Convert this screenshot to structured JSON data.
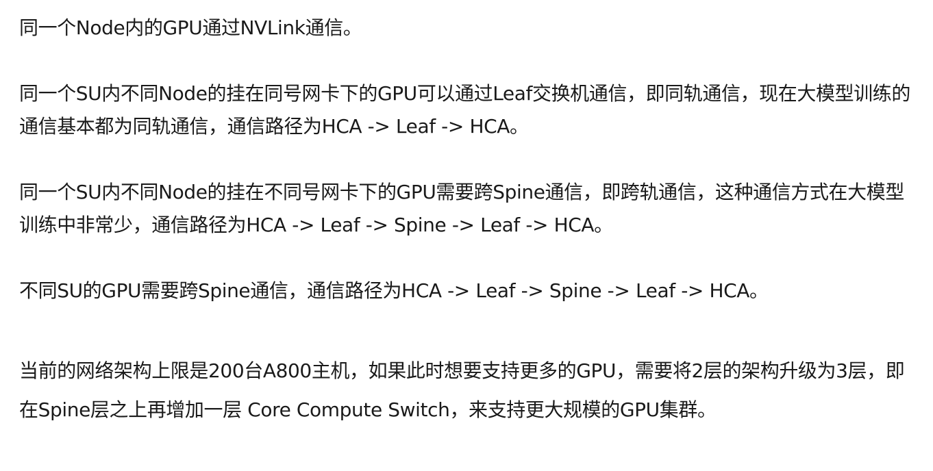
{
  "paragraphs": [
    "同一个Node内的GPU通过NVLink通信。",
    "同一个SU内不同Node的挂在同号网卡下的GPU可以通过Leaf交换机通信，即同轨通信，现在大模型训练的通信基本都为同轨通信，通信路径为HCA -> Leaf -> HCA。",
    "同一个SU内不同Node的挂在不同号网卡下的GPU需要跨Spine通信，即跨轨通信，这种通信方式在大模型训练中非常少，通信路径为HCA -> Leaf -> Spine -> Leaf -> HCA。",
    "不同SU的GPU需要跨Spine通信，通信路径为HCA -> Leaf -> Spine -> Leaf -> HCA。",
    "当前的网络架构上限是200台A800主机，如果此时想要支持更多的GPU，需要将2层的架构升级为3层，即在Spine层之上再增加一层 Core Compute Switch，来支持更大规模的GPU集群。"
  ]
}
